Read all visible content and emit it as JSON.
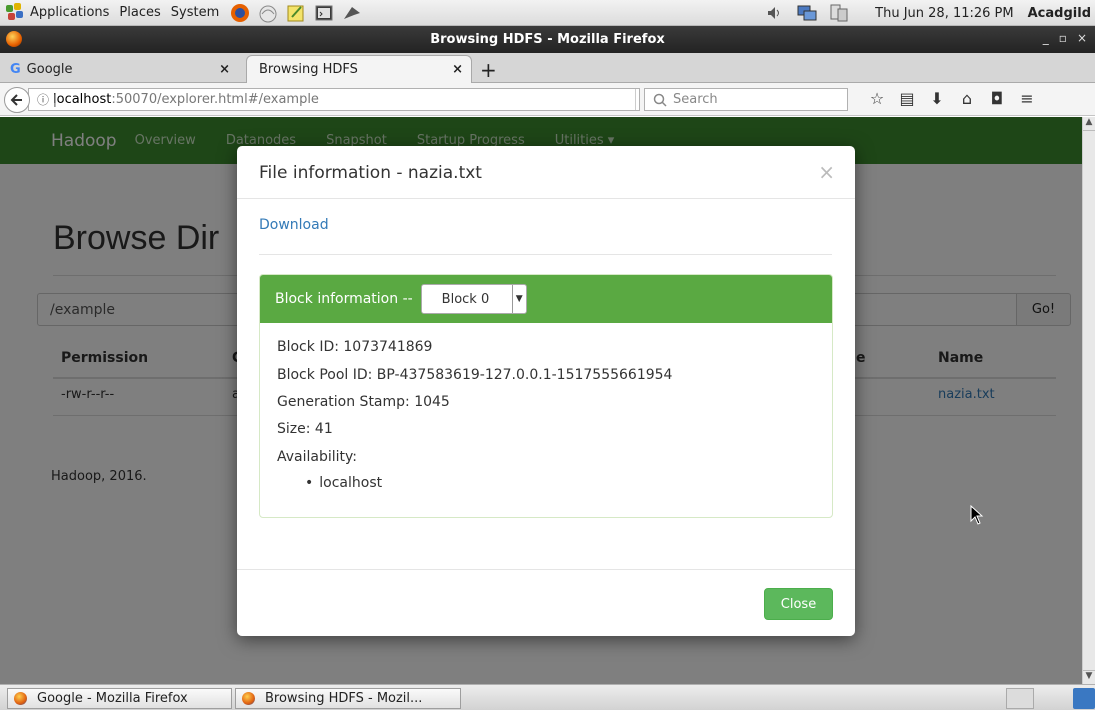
{
  "top_panel": {
    "menus": [
      "Applications",
      "Places",
      "System"
    ],
    "clock": "Thu Jun 28, 11:26 PM",
    "user": "Acadgild",
    "icons": [
      "applications-icon",
      "firefox-icon",
      "network-icon",
      "text-editor-icon",
      "terminal-icon",
      "screenshot-icon",
      "volume-icon",
      "network-status-icon",
      "display-icon"
    ]
  },
  "window": {
    "title": "Browsing HDFS - Mozilla Firefox",
    "controls": [
      "_",
      "▫",
      "×"
    ]
  },
  "tabs": [
    {
      "label": "Google",
      "close": "×"
    },
    {
      "label": "Browsing HDFS",
      "close": "×"
    }
  ],
  "new_tab": "+",
  "nav": {
    "url_host": "localhost",
    "url_path": ":50070/explorer.html#/example",
    "search_placeholder": "Search"
  },
  "hadoop": {
    "brand": "Hadoop",
    "nav_links": [
      "Overview",
      "Datanodes",
      "Snapshot",
      "Startup Progress",
      "Utilities ▾"
    ],
    "page_title": "Browse Dir",
    "path_value": "/example",
    "go_label": "Go!",
    "columns": {
      "permission": "Permission",
      "owner": "C",
      "size": "e",
      "name": "Name"
    },
    "row": {
      "permission": "-rw-r--r--",
      "owner": "a",
      "name": "nazia.txt"
    },
    "footer": "Hadoop, 2016."
  },
  "modal": {
    "title": "File information - nazia.txt",
    "close_x": "×",
    "download": "Download",
    "block_heading": "Block information --",
    "block_selected": "Block 0",
    "block_id": "Block ID: 1073741869",
    "block_pool": "Block Pool ID: BP-437583619-127.0.0.1-1517555661954",
    "generation": "Generation Stamp: 1045",
    "size": "Size: 41",
    "availability": "Availability:",
    "locations": [
      "localhost"
    ],
    "close_button": "Close"
  },
  "taskbar": {
    "items": [
      "Google - Mozilla Firefox",
      "Browsing HDFS - Mozil..."
    ]
  },
  "colors": {
    "hadoop_green": "#3c8c2e",
    "panel_green": "#5aa942",
    "button_green": "#5cb85c",
    "link_blue": "#337ab7"
  }
}
